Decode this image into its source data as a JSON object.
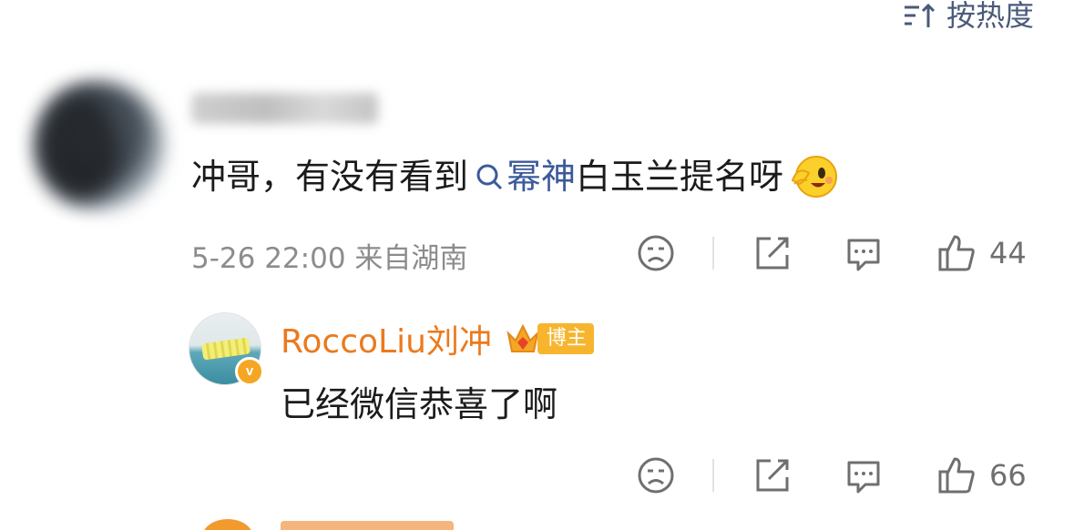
{
  "sort": {
    "label": "按热度",
    "icon": "sort-icon"
  },
  "comment": {
    "text_before": "冲哥，有没有看到",
    "link_text": "幂神",
    "text_after": "白玉兰提名呀",
    "emoji": "blush-wink-emoji",
    "meta": "5-26 22:00 来自湖南",
    "like_count": "44"
  },
  "reply": {
    "author": "RoccoLiu刘冲",
    "badge": "博主",
    "verified_mark": "v",
    "text": "已经微信恭喜了啊",
    "like_count": "66"
  },
  "colors": {
    "link": "#3c5a9a",
    "author": "#eb7a1d",
    "meta": "#8c8c8c",
    "icon": "#6f6f6f"
  }
}
